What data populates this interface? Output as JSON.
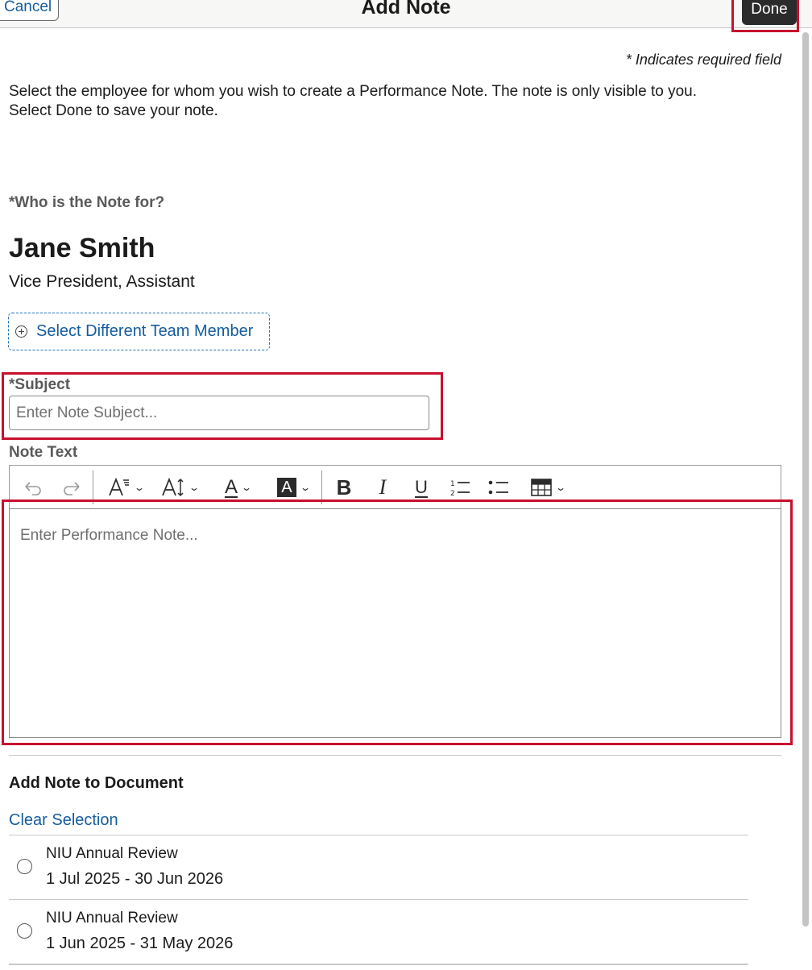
{
  "header": {
    "cancel_label": "Cancel",
    "title": "Add Note",
    "done_label": "Done"
  },
  "required_note": "* Indicates required field",
  "instructions": {
    "line1": "Select the employee for whom you wish to create a Performance Note. The note is only visible to you.",
    "line2": "Select Done to save your note."
  },
  "who": {
    "label": "*Who is the Note for?",
    "name": "Jane Smith",
    "title": "Vice President, Assistant",
    "select_label": "Select Different Team Member"
  },
  "subject": {
    "label": "*Subject",
    "placeholder": "Enter Note Subject...",
    "value": ""
  },
  "note_text": {
    "label": "Note Text",
    "placeholder": "Enter Performance Note...",
    "toolbar": {
      "undo_icon": "undo-icon",
      "redo_icon": "redo-icon",
      "font_family_icon": "font-family-icon",
      "font_size_icon": "font-size-icon",
      "font_color_icon": "font-color-icon",
      "highlight_icon": "highlight-color-icon",
      "bold_icon": "bold-icon",
      "italic_icon": "italic-icon",
      "underline_icon": "underline-icon",
      "ordered_list_icon": "ordered-list-icon",
      "bullet_list_icon": "bullet-list-icon",
      "table_icon": "table-icon",
      "font_color_glyph": "A",
      "highlight_glyph": "A",
      "bold_glyph": "B",
      "italic_glyph": "I",
      "underline_glyph": "U"
    }
  },
  "documents": {
    "heading": "Add Note to Document",
    "clear_label": "Clear Selection",
    "items": [
      {
        "title": "NIU Annual Review",
        "dates": "1 Jul 2025 - 30 Jun 2026",
        "selected": false
      },
      {
        "title": "NIU Annual Review",
        "dates": "1 Jun 2025 - 31 May 2026",
        "selected": false
      }
    ]
  },
  "colors": {
    "link": "#145c9e",
    "highlight_border": "#c8102e",
    "done_bg": "#2b2b2b"
  }
}
